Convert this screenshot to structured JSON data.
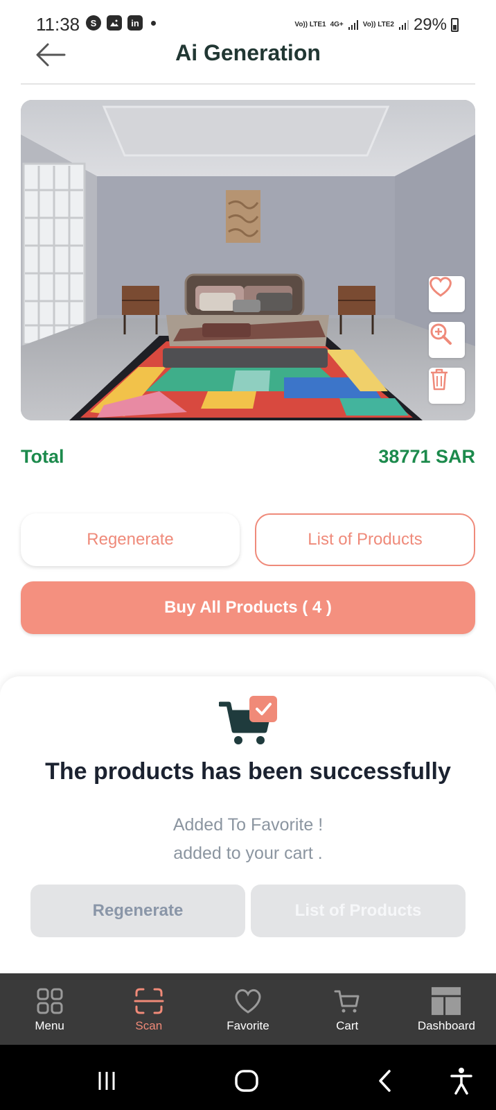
{
  "status_bar": {
    "time": "11:38",
    "network_1": "Vo)) LTE1",
    "network_type": "4G+",
    "network_2": "Vo)) LTE2",
    "battery": "29%"
  },
  "header": {
    "title": "Ai Generation",
    "back_icon": "arrow-left-icon"
  },
  "room_actions": [
    {
      "name": "favorite-button",
      "icon": "heart-icon"
    },
    {
      "name": "zoom-button",
      "icon": "zoom-in-icon"
    },
    {
      "name": "delete-button",
      "icon": "trash-icon"
    }
  ],
  "summary": {
    "total_label": "Total",
    "total_value": "38771 SAR"
  },
  "actions": {
    "regenerate": "Regenerate",
    "list_products": "List of Products",
    "buy_all": "Buy All Products ( 4 )"
  },
  "sheet": {
    "icon": "cart-check-icon",
    "title": "The products has been successfully",
    "line1": "Added To Favorite !",
    "line2": "added to your cart .",
    "regenerate": "Regenerate",
    "list_products": "List of Products"
  },
  "bottom_nav": {
    "active": "Scan",
    "items": [
      {
        "label": "Menu",
        "icon": "grid-icon"
      },
      {
        "label": "Scan",
        "icon": "scan-icon"
      },
      {
        "label": "Favorite",
        "icon": "heart-icon"
      },
      {
        "label": "Cart",
        "icon": "cart-icon"
      },
      {
        "label": "Dashboard",
        "icon": "dashboard-icon"
      }
    ]
  },
  "colors": {
    "accent": "#f4907f",
    "title": "#213733",
    "total": "#1c8a4c",
    "nav_background": "#3a3a3a",
    "nav_active": "#f08a78"
  }
}
